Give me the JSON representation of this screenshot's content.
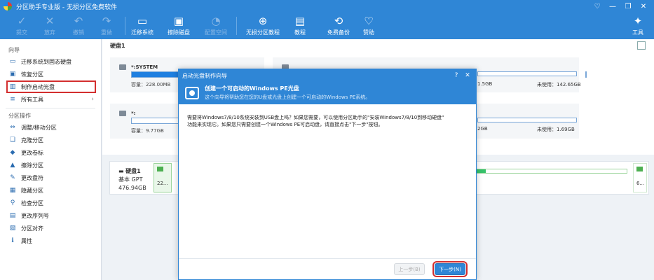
{
  "window": {
    "title": "分区助手专业版 - 无损分区免费软件",
    "controls": [
      "♡",
      "—",
      "❐",
      "✕"
    ]
  },
  "toolbar": {
    "buttons": [
      {
        "label": "提交",
        "icon": "✓",
        "enabled": false
      },
      {
        "label": "放弃",
        "icon": "✕",
        "enabled": false
      },
      {
        "label": "撤销",
        "icon": "↶",
        "enabled": false
      },
      {
        "label": "重做",
        "icon": "↷",
        "enabled": false
      },
      {
        "label": "迁移系统",
        "icon": "▭",
        "enabled": true
      },
      {
        "label": "擦除磁盘",
        "icon": "▣",
        "enabled": true
      },
      {
        "label": "配置空间",
        "icon": "◔",
        "enabled": false
      },
      {
        "label": "无损分区教程",
        "icon": "⊕",
        "enabled": true
      },
      {
        "label": "教程",
        "icon": "▤",
        "enabled": true
      },
      {
        "label": "免费备份",
        "icon": "⟲",
        "enabled": true
      },
      {
        "label": "赞助",
        "icon": "♡",
        "enabled": true
      },
      {
        "label": "工具",
        "icon": "✦",
        "enabled": true
      }
    ]
  },
  "sidebar": {
    "wizard_title": "向导",
    "wizard_items": [
      {
        "label": "迁移系统到固态硬盘",
        "icon": "▭"
      },
      {
        "label": "恢复分区",
        "icon": "▣"
      },
      {
        "label": "制作启动光盘",
        "icon": "▥"
      },
      {
        "label": "所有工具",
        "icon": "≡"
      }
    ],
    "ops_title": "分区操作",
    "ops_items": [
      {
        "label": "调整/移动分区",
        "icon": "⇔"
      },
      {
        "label": "克隆分区",
        "icon": "❏"
      },
      {
        "label": "更改卷标",
        "icon": "◆"
      },
      {
        "label": "擦除分区",
        "icon": "▲"
      },
      {
        "label": "更改盘符",
        "icon": "✎"
      },
      {
        "label": "隐藏分区",
        "icon": "▦"
      },
      {
        "label": "检查分区",
        "icon": "⚲"
      },
      {
        "label": "更改序列号",
        "icon": "▤"
      },
      {
        "label": "分区对齐",
        "icon": "▧"
      },
      {
        "label": "属性",
        "icon": "ℹ"
      }
    ]
  },
  "main": {
    "disk_header": "硬盘1",
    "cards": [
      {
        "name": "*:SYSTEM",
        "capacity": "容量：228.00MB",
        "free": "",
        "fill": 0.95
      },
      {
        "name": "",
        "capacity": "",
        "free": "未使用：142.65GB",
        "fill": 0.0
      },
      {
        "name": "*:",
        "capacity": "容量：9.77GB",
        "free": "",
        "fill": 0.0
      },
      {
        "name": "",
        "capacity": "",
        "free": "未使用：1.69GB",
        "fill": 0.0
      }
    ],
    "right_frag_1": "1.5GB",
    "right_frag_2": "2GB",
    "disk_row": {
      "title": "硬盘1",
      "type": "基本 GPT",
      "size": "476.94GB",
      "seg1": "22...",
      "seg_end": "6..."
    }
  },
  "dialog": {
    "title": "启动光盘制作向导",
    "heading": "创建一个可启动的Windows PE光盘",
    "subheading": "这个向导将帮助您在您的U盘或光盘上创建一个可启动的Windows PE系统。",
    "body_line1": "需要将Windows7/8/10系统安装到USB盘上吗？如果您需要，可以使用分区助手的\"安装Windows7/8/10到移动硬盘\"",
    "body_line2": "功能来实现它。如果您只需要创建一个Windows PE可启动盘，请直接点击\"下一步\"按钮。",
    "prev_label": "上一步(B)",
    "next_label": "下一步(N)",
    "controls": [
      "?",
      "✕"
    ]
  }
}
